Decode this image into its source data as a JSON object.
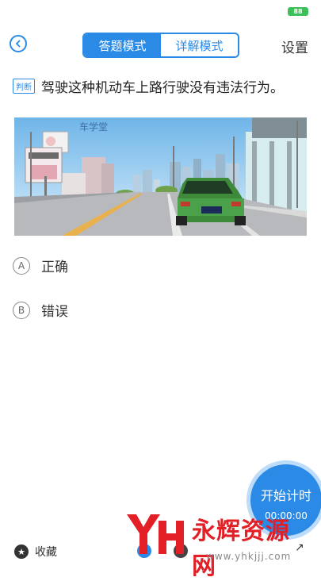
{
  "status": {
    "battery": "88"
  },
  "header": {
    "tabs": [
      "答题模式",
      "详解模式"
    ],
    "settings_label": "设置"
  },
  "question": {
    "tag": "判断",
    "text": "驾驶这种机动车上路行驶没有违法行为。"
  },
  "image": {
    "watermark": "车学堂"
  },
  "options": [
    {
      "letter": "A",
      "text": "正确"
    },
    {
      "letter": "B",
      "text": "错误"
    }
  ],
  "timer": {
    "label": "开始计时",
    "time": "00:00:00"
  },
  "bottom": {
    "favorite_label": "收藏"
  },
  "watermark": {
    "main": "永辉资源网",
    "url": "www.yhkjjj.com"
  },
  "colors": {
    "accent": "#2a8ae6",
    "watermark_red": "#e21e26"
  }
}
